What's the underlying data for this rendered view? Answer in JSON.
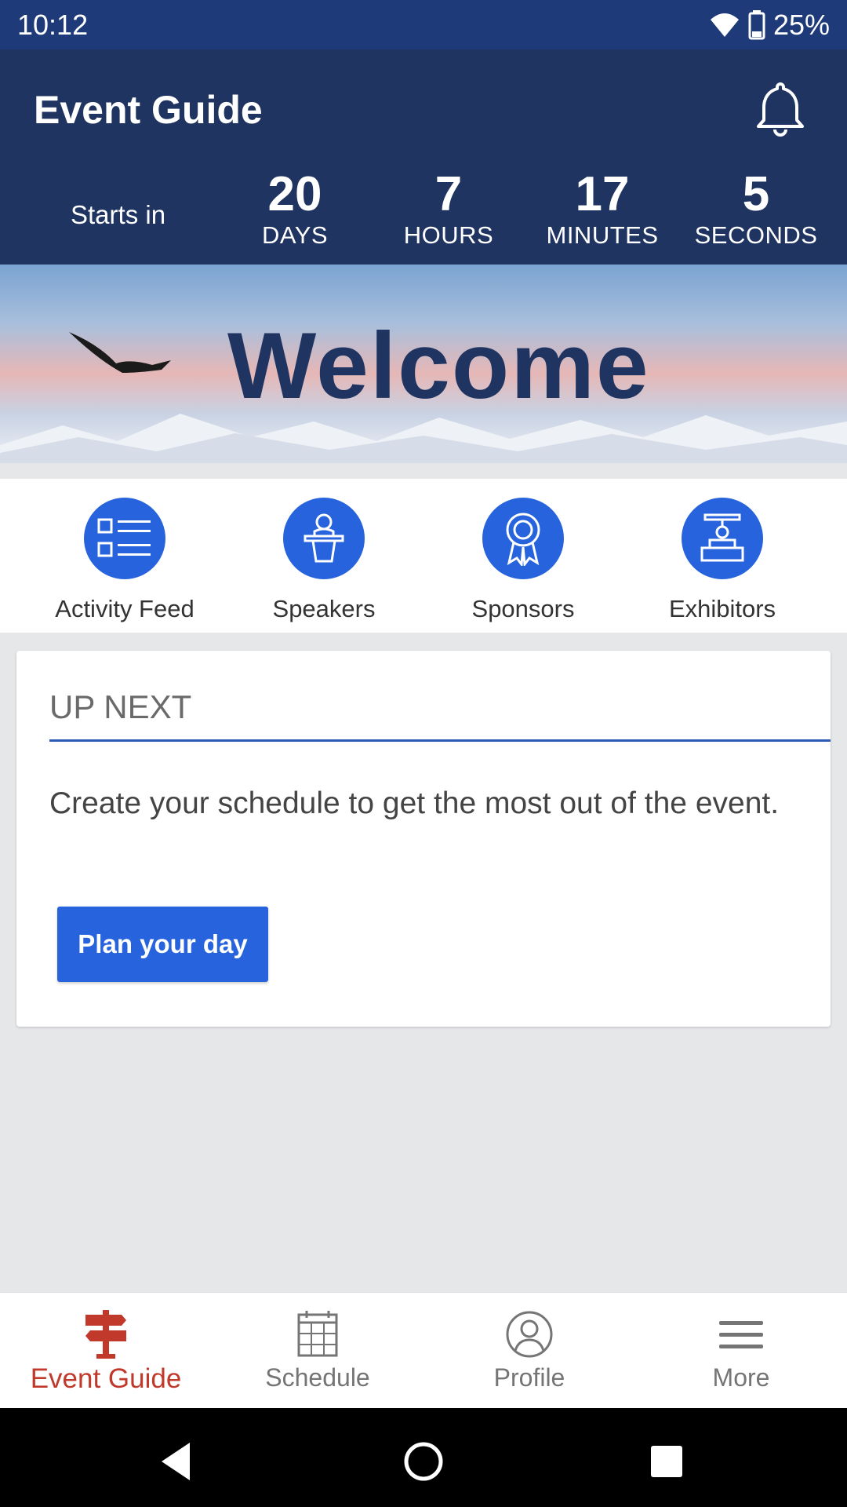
{
  "status_bar": {
    "time": "10:12",
    "battery": "25%"
  },
  "header": {
    "title": "Event Guide",
    "countdown": {
      "label": "Starts in",
      "units": [
        {
          "value": "20",
          "label": "DAYS"
        },
        {
          "value": "7",
          "label": "HOURS"
        },
        {
          "value": "17",
          "label": "MINUTES"
        },
        {
          "value": "5",
          "label": "SECONDS"
        }
      ]
    }
  },
  "banner": {
    "text": "Welcome"
  },
  "quick_nav": [
    {
      "label": "Activity Feed",
      "icon": "list-icon"
    },
    {
      "label": "Speakers",
      "icon": "podium-speaker-icon"
    },
    {
      "label": "Sponsors",
      "icon": "ribbon-award-icon"
    },
    {
      "label": "Exhibitors",
      "icon": "booth-icon"
    }
  ],
  "up_next": {
    "title": "UP NEXT",
    "message": "Create your schedule to get the most out of the event.",
    "button_label": "Plan your day"
  },
  "tabs": [
    {
      "label": "Event Guide",
      "icon": "signpost-icon",
      "active": true
    },
    {
      "label": "Schedule",
      "icon": "calendar-icon",
      "active": false
    },
    {
      "label": "Profile",
      "icon": "profile-icon",
      "active": false
    },
    {
      "label": "More",
      "icon": "menu-icon",
      "active": false
    }
  ],
  "colors": {
    "status_bar": "#1e3a78",
    "header": "#1f3460",
    "accent": "#2763dc",
    "active_tab": "#c0392b"
  }
}
